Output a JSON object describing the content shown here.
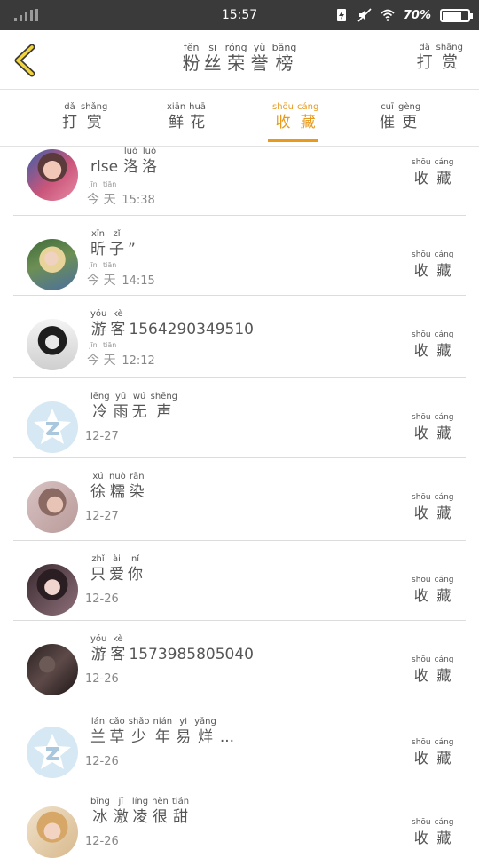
{
  "status_bar": {
    "time": "15:57",
    "battery_percent": "70%"
  },
  "header": {
    "back_icon": "chevron-left-icon",
    "title": [
      {
        "py": "fěn",
        "hz": "粉"
      },
      {
        "py": "sī",
        "hz": "丝"
      },
      {
        "py": "róng",
        "hz": "荣"
      },
      {
        "py": "yù",
        "hz": "誉"
      },
      {
        "py": "bǎng",
        "hz": "榜"
      }
    ],
    "reward_button": [
      {
        "py": "dǎ",
        "hz": "打"
      },
      {
        "py": "shǎng",
        "hz": "赏"
      }
    ]
  },
  "tabs": [
    {
      "id": "reward",
      "active": false,
      "chars": [
        {
          "py": "dǎ",
          "hz": "打"
        },
        {
          "py": "shǎng",
          "hz": "赏"
        }
      ]
    },
    {
      "id": "flowers",
      "active": false,
      "chars": [
        {
          "py": "xiān",
          "hz": "鲜"
        },
        {
          "py": "huā",
          "hz": "花"
        }
      ]
    },
    {
      "id": "favorites",
      "active": true,
      "chars": [
        {
          "py": "shōu",
          "hz": "收"
        },
        {
          "py": "cáng",
          "hz": "藏"
        }
      ]
    },
    {
      "id": "urge",
      "active": false,
      "chars": [
        {
          "py": "cuī",
          "hz": "催"
        },
        {
          "py": "gèng",
          "hz": "更"
        }
      ]
    }
  ],
  "accent_color": "#e89a1c",
  "fav_label": [
    {
      "py": "shōu",
      "hz": "收"
    },
    {
      "py": "cáng",
      "hz": "藏"
    }
  ],
  "users": [
    {
      "prefix": "rlse",
      "chars": [
        {
          "py": "luò",
          "hz": "洛"
        },
        {
          "py": "luò",
          "hz": "洛"
        }
      ],
      "suffix": "",
      "time_chars": [
        {
          "py": "jīn",
          "hz": "今"
        },
        {
          "py": "tiān",
          "hz": "天"
        }
      ],
      "time": "15:38",
      "avatar": "photo-girl-pink"
    },
    {
      "prefix": "",
      "chars": [
        {
          "py": "xīn",
          "hz": "昕"
        },
        {
          "py": "zǐ",
          "hz": "子"
        }
      ],
      "suffix": "”",
      "time_chars": [
        {
          "py": "jīn",
          "hz": "今"
        },
        {
          "py": "tiān",
          "hz": "天"
        }
      ],
      "time": "14:15",
      "avatar": "photo-girl-blonde"
    },
    {
      "prefix": "",
      "chars": [
        {
          "py": "yóu",
          "hz": "游"
        },
        {
          "py": "kè",
          "hz": "客"
        }
      ],
      "suffix": "1564290349510",
      "time_chars": [
        {
          "py": "jīn",
          "hz": "今"
        },
        {
          "py": "tiān",
          "hz": "天"
        }
      ],
      "time": "12:12",
      "avatar": "photo-girl-bw"
    },
    {
      "prefix": "",
      "chars": [
        {
          "py": "lěng",
          "hz": "冷"
        },
        {
          "py": "yǔ",
          "hz": "雨"
        },
        {
          "py": "wú",
          "hz": "无"
        },
        {
          "py": "shēng",
          "hz": "声"
        }
      ],
      "suffix": "",
      "time_chars": [],
      "time": "12-27",
      "avatar": "default-qq-icon"
    },
    {
      "prefix": "",
      "chars": [
        {
          "py": "xú",
          "hz": "徐"
        },
        {
          "py": "nuò",
          "hz": "糯"
        },
        {
          "py": "rǎn",
          "hz": "染"
        }
      ],
      "suffix": "",
      "time_chars": [],
      "time": "12-27",
      "avatar": "photo-girl-soft"
    },
    {
      "prefix": "",
      "chars": [
        {
          "py": "zhǐ",
          "hz": "只"
        },
        {
          "py": "ài",
          "hz": "爱"
        },
        {
          "py": "nǐ",
          "hz": "你"
        }
      ],
      "suffix": "",
      "time_chars": [],
      "time": "12-26",
      "avatar": "photo-girl-dark"
    },
    {
      "prefix": "",
      "chars": [
        {
          "py": "yóu",
          "hz": "游"
        },
        {
          "py": "kè",
          "hz": "客"
        }
      ],
      "suffix": "1573985805040",
      "time_chars": [],
      "time": "12-26",
      "avatar": "photo-girl-phone"
    },
    {
      "prefix": "",
      "chars": [
        {
          "py": "lán",
          "hz": "兰"
        },
        {
          "py": "cǎo",
          "hz": "草"
        },
        {
          "py": "shǎo",
          "hz": "少"
        },
        {
          "py": "nián",
          "hz": "年"
        },
        {
          "py": "yì",
          "hz": "易"
        },
        {
          "py": "yǎng",
          "hz": "烊"
        }
      ],
      "suffix": "...",
      "time_chars": [],
      "time": "12-26",
      "avatar": "default-qq-icon"
    },
    {
      "prefix": "",
      "chars": [
        {
          "py": "bīng",
          "hz": "冰"
        },
        {
          "py": "jī",
          "hz": "激"
        },
        {
          "py": "líng",
          "hz": "凌"
        },
        {
          "py": "hěn",
          "hz": "很"
        },
        {
          "py": "tián",
          "hz": "甜"
        }
      ],
      "suffix": "",
      "time_chars": [],
      "time": "12-26",
      "avatar": "photo-girl-blonde2"
    }
  ]
}
